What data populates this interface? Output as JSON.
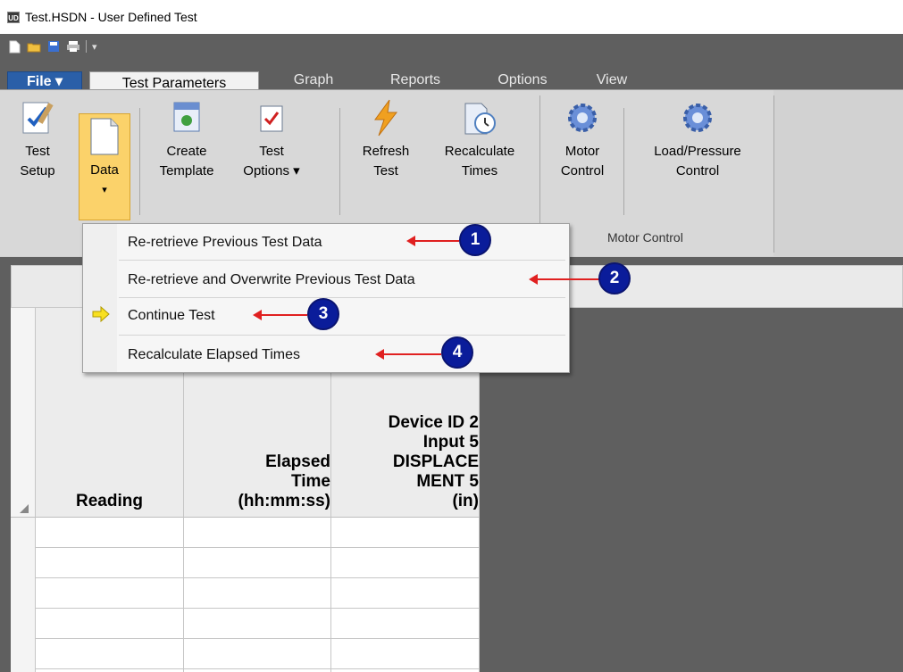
{
  "window": {
    "title": "Test.HSDN - User Defined Test"
  },
  "quick_access": {
    "icons": [
      "new-icon",
      "open-icon",
      "save-icon",
      "print-icon"
    ]
  },
  "tabs": [
    {
      "label": "File ▾"
    },
    {
      "label": "Test Parameters"
    },
    {
      "label": "Graph"
    },
    {
      "label": "Reports"
    },
    {
      "label": "Options"
    },
    {
      "label": "View"
    }
  ],
  "ribbon": {
    "buttons": [
      {
        "line1": "Test",
        "line2": "Setup"
      },
      {
        "line1": "Data",
        "line2": "▾"
      },
      {
        "line1": "Create",
        "line2": "Template"
      },
      {
        "line1": "Test",
        "line2": "Options ▾"
      },
      {
        "line1": "Refresh",
        "line2": "Test"
      },
      {
        "line1": "Recalculate",
        "line2": "Times"
      },
      {
        "line1": "Motor",
        "line2": "Control"
      },
      {
        "line1": "Load/Pressure",
        "line2": "Control"
      }
    ],
    "group_label": "Motor Control"
  },
  "menu": {
    "items": [
      {
        "label": "Re-retrieve Previous Test Data",
        "marker": "1"
      },
      {
        "label": "Re-retrieve and Overwrite Previous Test Data",
        "marker": "2"
      },
      {
        "label": "Continue Test",
        "marker": "3"
      },
      {
        "label": "Recalculate Elapsed Times",
        "marker": "4"
      }
    ]
  },
  "grid": {
    "headers": [
      {
        "lines": [
          "Reading"
        ]
      },
      {
        "lines": [
          "Elapsed",
          "Time",
          "(hh:mm:ss)"
        ]
      },
      {
        "lines": [
          "Device ID 2",
          "Input 5",
          "DISPLACE",
          "MENT 5",
          "(in)"
        ]
      }
    ]
  },
  "colors": {
    "accent_file_tab": "#2a5fa8",
    "active_button": "#fbd26a",
    "marker": "#0a1c9a",
    "arrow": "#e02020"
  }
}
